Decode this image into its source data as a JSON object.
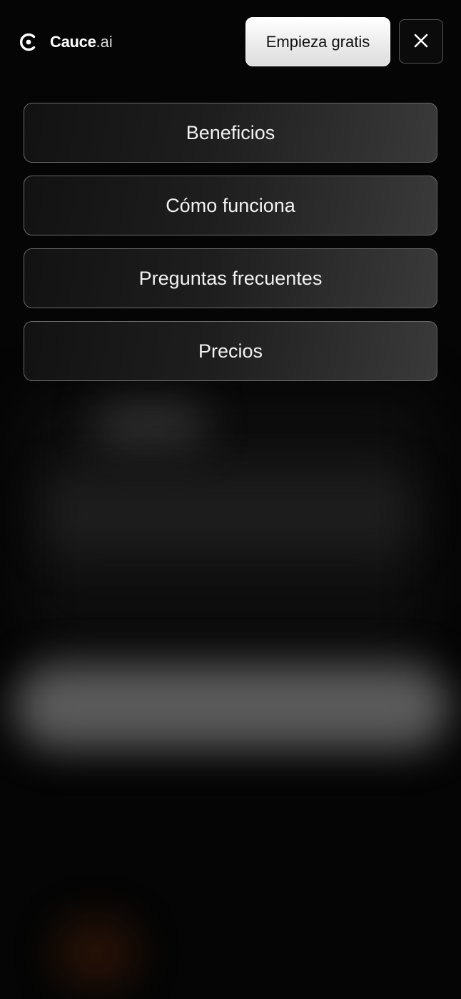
{
  "brand": {
    "name": "Cauce",
    "suffix": ".ai",
    "icon": "cauce-logo-icon"
  },
  "header": {
    "cta_label": "Empieza gratis",
    "close_icon": "close-icon"
  },
  "menu": {
    "items": [
      {
        "label": "Beneficios"
      },
      {
        "label": "Cómo funciona"
      },
      {
        "label": "Preguntas frecuentes"
      },
      {
        "label": "Precios"
      }
    ]
  },
  "colors": {
    "background": "#050505",
    "cta_background": "#ffffff",
    "menu_border": "#6a6a6a",
    "text": "#ffffff"
  }
}
